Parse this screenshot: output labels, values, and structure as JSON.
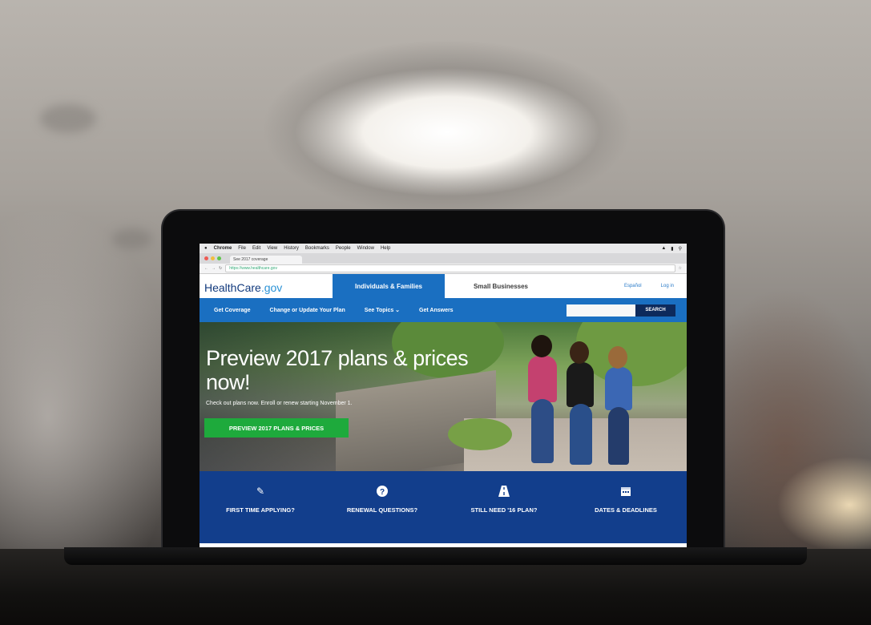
{
  "colors": {
    "brand_blue": "#1a6fc1",
    "dark_blue": "#123e8c",
    "green": "#1eaa3c",
    "logo_navy": "#123a7d",
    "logo_light": "#2a92d6"
  },
  "menubar": {
    "app": "Chrome",
    "items": [
      "File",
      "Edit",
      "View",
      "History",
      "Bookmarks",
      "People",
      "Window",
      "Help"
    ]
  },
  "browser": {
    "tab_title": "See 2017 coverage",
    "url": "https://www.healthcare.gov"
  },
  "site": {
    "logo_main": "HealthCare",
    "logo_suffix": ".gov",
    "audience_active": "Individuals & Families",
    "audience_other": "Small Businesses",
    "language": "Español",
    "login": "Log in"
  },
  "nav": {
    "items": [
      "Get Coverage",
      "Change or Update Your Plan",
      "See Topics ⌄",
      "Get Answers"
    ],
    "search_button": "SEARCH"
  },
  "hero": {
    "title": "Preview 2017 plans & prices now!",
    "subtitle": "Check out plans now. Enroll or renew starting November 1.",
    "button": "PREVIEW 2017 PLANS & PRICES"
  },
  "quick_links": [
    {
      "label": "FIRST TIME APPLYING?",
      "icon": "pencil-edit-icon"
    },
    {
      "label": "RENEWAL QUESTIONS?",
      "icon": "question-circle-icon"
    },
    {
      "label": "STILL NEED '16 PLAN?",
      "icon": "road-icon"
    },
    {
      "label": "DATES & DEADLINES",
      "icon": "calendar-icon"
    }
  ]
}
